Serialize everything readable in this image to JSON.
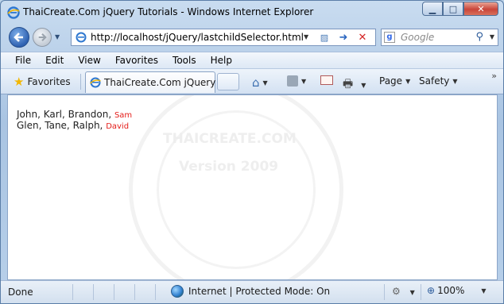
{
  "window": {
    "title": "ThaiCreate.Com jQuery Tutorials - Windows Internet Explorer",
    "caption_buttons": [
      "minimize-icon",
      "maximize-icon",
      "close-icon"
    ]
  },
  "address": {
    "url": "http://localhost/jQuery/lastchildSelector.html",
    "search_placeholder": "Google"
  },
  "menu": [
    "File",
    "Edit",
    "View",
    "Favorites",
    "Tools",
    "Help"
  ],
  "favorites_bar": {
    "favorites_label": "Favorites",
    "tab_label": "ThaiCreate.Com jQuery ...",
    "page_label": "Page",
    "safety_label": "Safety"
  },
  "content": {
    "lines": [
      {
        "text": "John, Karl, Brandon, ",
        "last": "Sam"
      },
      {
        "text": "Glen, Tane, Ralph, ",
        "last": "David"
      }
    ],
    "watermark": {
      "line1": "THAICREATE.COM",
      "line2": "Version 2009"
    }
  },
  "status": {
    "text": "Done",
    "zone": "Internet | Protected Mode: On",
    "zoom": "100%"
  },
  "colors": {
    "last_child_highlight": "#e41b17"
  }
}
